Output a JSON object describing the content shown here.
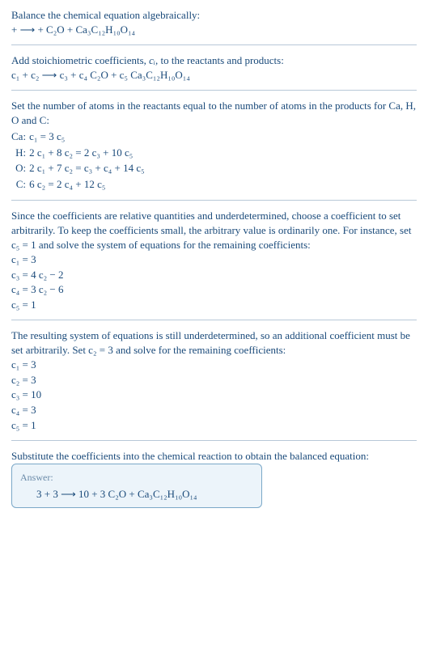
{
  "sec1": {
    "title": "Balance the chemical equation algebraically:",
    "eq": " +  ⟶  + C₂O + Ca₃C₁₂H₁₀O₁₄"
  },
  "sec2": {
    "title_a": "Add stoichiometric coefficients, ",
    "title_ci": "cᵢ",
    "title_b": ", to the reactants and products:",
    "eq": "c₁  + c₂  ⟶ c₃  + c₄ C₂O + c₅ Ca₃C₁₂H₁₀O₁₄"
  },
  "sec3": {
    "title": "Set the number of atoms in the reactants equal to the number of atoms in the products for Ca, H, O and C:",
    "rows": [
      {
        "lbl": "Ca:",
        "eq": "c₁ = 3 c₅"
      },
      {
        "lbl": "H:",
        "eq": "2 c₁ + 8 c₂ = 2 c₃ + 10 c₅"
      },
      {
        "lbl": "O:",
        "eq": "2 c₁ + 7 c₂ = c₃ + c₄ + 14 c₅"
      },
      {
        "lbl": "C:",
        "eq": "6 c₂ = 2 c₄ + 12 c₅"
      }
    ]
  },
  "sec4": {
    "title": "Since the coefficients are relative quantities and underdetermined, choose a coefficient to set arbitrarily. To keep the coefficients small, the arbitrary value is ordinarily one. For instance, set c₅ = 1 and solve the system of equations for the remaining coefficients:",
    "lines": [
      "c₁ = 3",
      "c₃ = 4 c₂ − 2",
      "c₄ = 3 c₂ − 6",
      "c₅ = 1"
    ]
  },
  "sec5": {
    "title": "The resulting system of equations is still underdetermined, so an additional coefficient must be set arbitrarily. Set c₂ = 3 and solve for the remaining coefficients:",
    "lines": [
      "c₁ = 3",
      "c₂ = 3",
      "c₃ = 10",
      "c₄ = 3",
      "c₅ = 1"
    ]
  },
  "sec6": {
    "title": "Substitute the coefficients into the chemical reaction to obtain the balanced equation:",
    "answer_label": "Answer:",
    "answer_eq": "3  + 3  ⟶ 10  + 3 C₂O + Ca₃C₁₂H₁₀O₁₄"
  },
  "chart_data": {
    "type": "table",
    "title": "Algebraic balancing of chemical equation",
    "unknown_product": "Ca3C12H10O14",
    "other_product": "C2O",
    "atom_balance": [
      {
        "element": "Ca",
        "equation": "c1 = 3 c5"
      },
      {
        "element": "H",
        "equation": "2 c1 + 8 c2 = 2 c3 + 10 c5"
      },
      {
        "element": "O",
        "equation": "2 c1 + 7 c2 = c3 + c4 + 14 c5"
      },
      {
        "element": "C",
        "equation": "6 c2 = 2 c4 + 12 c5"
      }
    ],
    "partial_solution_set_c5_1": {
      "c1": "3",
      "c3": "4 c2 - 2",
      "c4": "3 c2 - 6",
      "c5": "1"
    },
    "final_coefficients_set_c2_3": {
      "c1": 3,
      "c2": 3,
      "c3": 10,
      "c4": 3,
      "c5": 1
    },
    "balanced_equation": "3 + 3 ⟶ 10 + 3 C2O + Ca3C12H10O14"
  }
}
